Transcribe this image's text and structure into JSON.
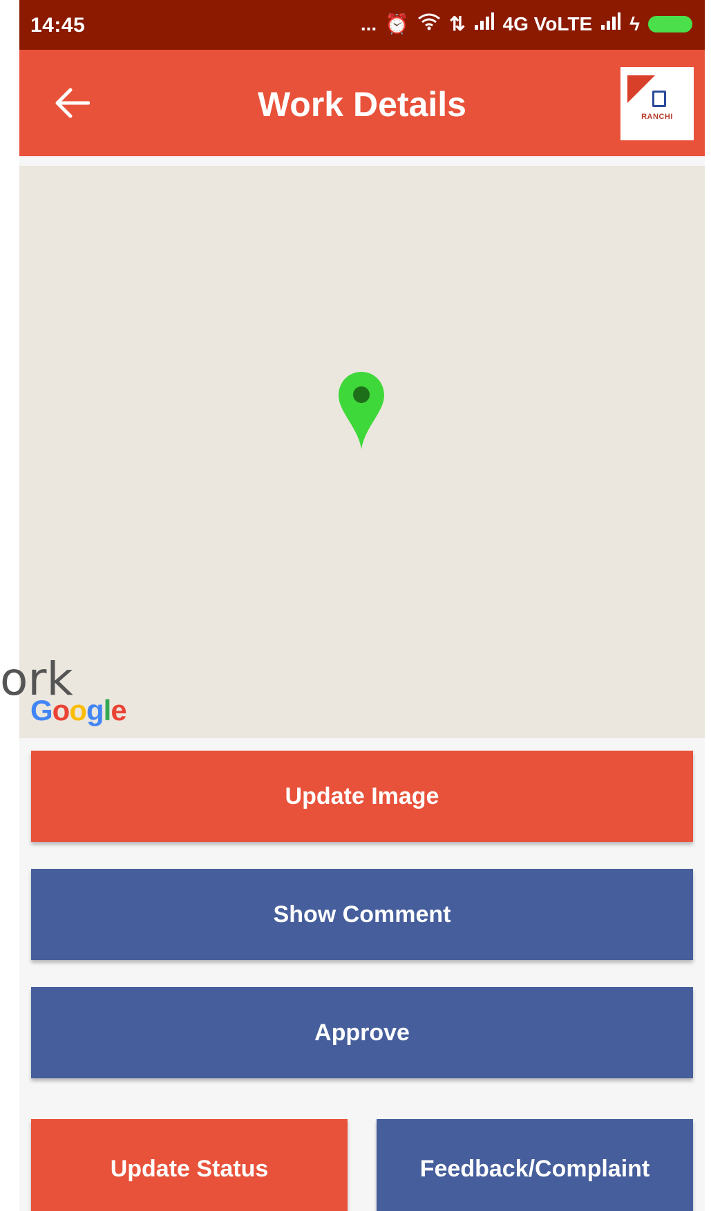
{
  "status_bar": {
    "time": "14:45",
    "network": "4G VoLTE",
    "dots": "..."
  },
  "app_bar": {
    "title": "Work Details",
    "logo_text": "RANCHI"
  },
  "map": {
    "attribution": {
      "G": "G",
      "o1": "o",
      "o2": "o",
      "g": "g",
      "l": "l",
      "e": "e"
    },
    "pin_color": "#3fd83a"
  },
  "buttons": {
    "update_image": "Update Image",
    "show_comment": "Show Comment",
    "approve": "Approve",
    "update_status": "Update Status",
    "feedback": "Feedback/Complaint"
  },
  "overlay_text": "ork",
  "colors": {
    "status_bar": "#8b1a00",
    "primary_red": "#e8523a",
    "primary_blue": "#465e9b",
    "map_bg": "#ebe7de"
  }
}
